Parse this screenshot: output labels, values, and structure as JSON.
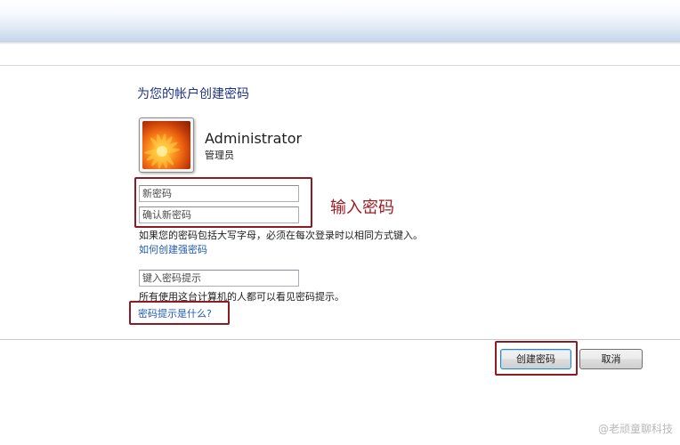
{
  "dialog": {
    "heading": "为您的帐户创建密码",
    "account": {
      "name": "Administrator",
      "role": "管理员"
    },
    "fields": {
      "new_password_placeholder": "新密码",
      "confirm_password_placeholder": "确认新密码",
      "hint_placeholder": "键入密码提示"
    },
    "annotation": "输入密码",
    "info_text": "如果您的密码包括大写字母，必须在每次登录时以相同方式键入。",
    "strong_password_link": "如何创建强密码",
    "hint_warning": "所有使用这台计算机的人都可以看见密码提示。",
    "hint_help_link": "密码提示是什么?",
    "buttons": {
      "create": "创建密码",
      "cancel": "取消"
    }
  },
  "watermark": "@老顽童聊科技",
  "colors": {
    "annotation_red": "#9b1c23",
    "link_blue": "#1f5bb8",
    "heading_blue": "#1e3287"
  }
}
